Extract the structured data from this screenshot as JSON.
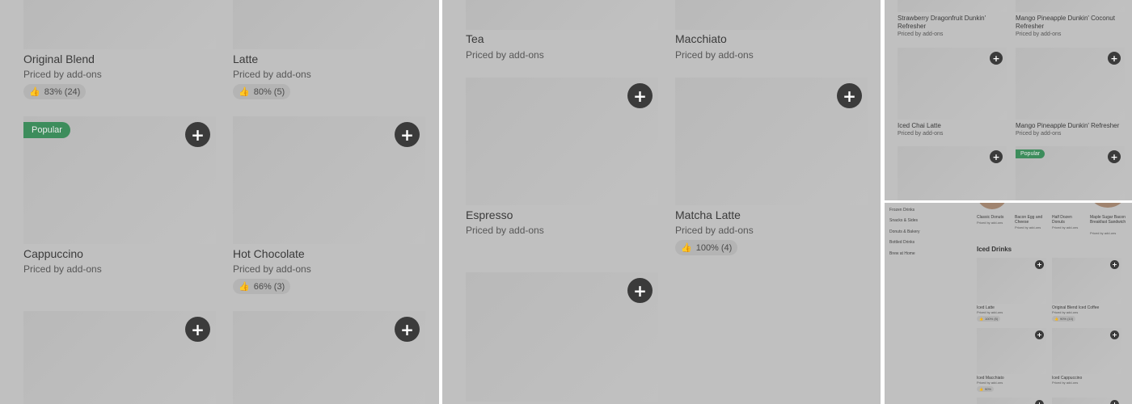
{
  "panel1": {
    "items": [
      {
        "name": "Original Blend",
        "price": "Priced by add-ons",
        "rating": "83% (24)"
      },
      {
        "name": "Latte",
        "price": "Priced by add-ons",
        "rating": "80% (5)"
      },
      {
        "name": "Cappuccino",
        "price": "Priced by add-ons",
        "badge": "Popular"
      },
      {
        "name": "Hot Chocolate",
        "price": "Priced by add-ons",
        "rating": "66% (3)"
      }
    ]
  },
  "panel2": {
    "items": [
      {
        "name": "Tea",
        "price": "Priced by add-ons"
      },
      {
        "name": "Macchiato",
        "price": "Priced by add-ons"
      },
      {
        "name": "Espresso",
        "price": "Priced by add-ons"
      },
      {
        "name": "Matcha Latte",
        "price": "Priced by add-ons",
        "rating": "100% (4)"
      }
    ]
  },
  "panel3": {
    "items": [
      {
        "name": "Strawberry Dragonfruit Dunkin' Refresher",
        "price": "Priced by add-ons"
      },
      {
        "name": "Mango Pineapple Dunkin' Coconut Refresher",
        "price": "Priced by add-ons"
      },
      {
        "name": "Iced Chai Latte",
        "price": "Priced by add-ons"
      },
      {
        "name": "Mango Pineapple Dunkin' Refresher",
        "price": "Priced by add-ons"
      }
    ],
    "badge": "Popular"
  },
  "panel4": {
    "categories": [
      "Frozen Drinks",
      "Snacks & Sides",
      "Donuts & Bakery",
      "Bottled Drinks",
      "Brew at Home"
    ],
    "top_items": [
      {
        "name": "Classic Donuts",
        "price": "Priced by add-ons"
      },
      {
        "name": "Bacon Egg and Cheese",
        "price": "Priced by add-ons"
      },
      {
        "name": "Half Dozen Donuts",
        "price": "Priced by add-ons"
      },
      {
        "name": "Maple Sugar Bacon Breakfast Sandwich",
        "price": "Priced by add-ons"
      }
    ],
    "section_title": "Iced Drinks",
    "items": [
      {
        "name": "Iced Latte",
        "price": "Priced by add-ons",
        "rating": "100% (5)"
      },
      {
        "name": "Original Blend Iced Coffee",
        "price": "Priced by add-ons",
        "rating": "90% (10)"
      },
      {
        "name": "Iced Macchiato",
        "price": "Priced by add-ons",
        "rating": "90%"
      },
      {
        "name": "Iced Cappuccino",
        "price": "Priced by add-ons"
      }
    ]
  },
  "icons": {
    "add": "+",
    "thumbs_up": "👍"
  },
  "colors": {
    "popular_badge": "#3d8d5c",
    "add_button": "#3b3b3b"
  }
}
